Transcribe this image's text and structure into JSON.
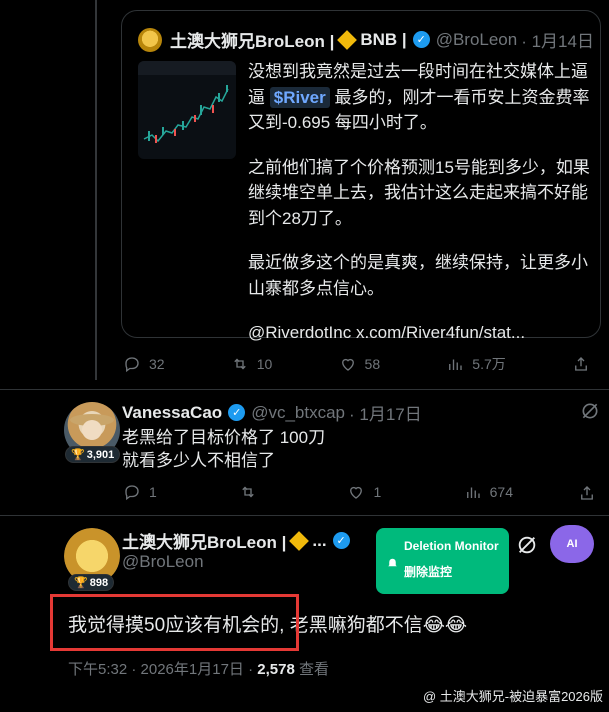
{
  "quote": {
    "name": "土澳大狮兄BroLeon |",
    "bnb": "BNB |",
    "handle": "@BroLeon",
    "date": "· 1月14日",
    "p1_a": "没想到我竟然是过去一段时间在社交媒体上逼逼",
    "cashtag": "$River",
    "p1_b": "最多的，刚才一看币安上资金费率又到-0.695 每四小时了。",
    "p2": "之前他们搞了个价格预测15号能到多少，如果继续堆空单上去，我估计这么走起来搞不好能到个28刀了。",
    "p3": "最近做多这个的是真爽，继续保持，让更多小山寨都多点信心。",
    "p4": "@RiverdotInc  x.com/River4fun/stat..."
  },
  "post1_actions": {
    "replies": "32",
    "reposts": "10",
    "likes": "58",
    "views": "5.7万"
  },
  "reply": {
    "name": "VanessaCao",
    "handle": "@vc_btxcap",
    "date": "· 1月17日",
    "line1": "老黑给了目标价格了 100刀",
    "line2": "就看多少人不相信了",
    "badge": "3,901",
    "actions": {
      "replies": "1",
      "reposts": "",
      "likes": "1",
      "views": "674"
    }
  },
  "main": {
    "name": "土澳大狮兄BroLeon |",
    "name_suffix": "...",
    "handle": "@BroLeon",
    "badge": "898",
    "text_a": "我觉得摸50应该有机会的,",
    "text_b": " 老黑嘛狗都不信😂😂",
    "time": "下午5:32 · 2026年1月17日 · ",
    "views_count": "2,578",
    "views_label": " 查看"
  },
  "monitor": {
    "title": "Deletion Monitor",
    "subtitle": "删除监控"
  },
  "ai_label": "AI",
  "watermark": "@ 土澳大狮兄-被迫暴富2026版",
  "colors": {
    "accent": "#1d9bf0",
    "monitor": "#00ba7c",
    "highlight": "#e53935",
    "ai": "#8b67e8"
  }
}
